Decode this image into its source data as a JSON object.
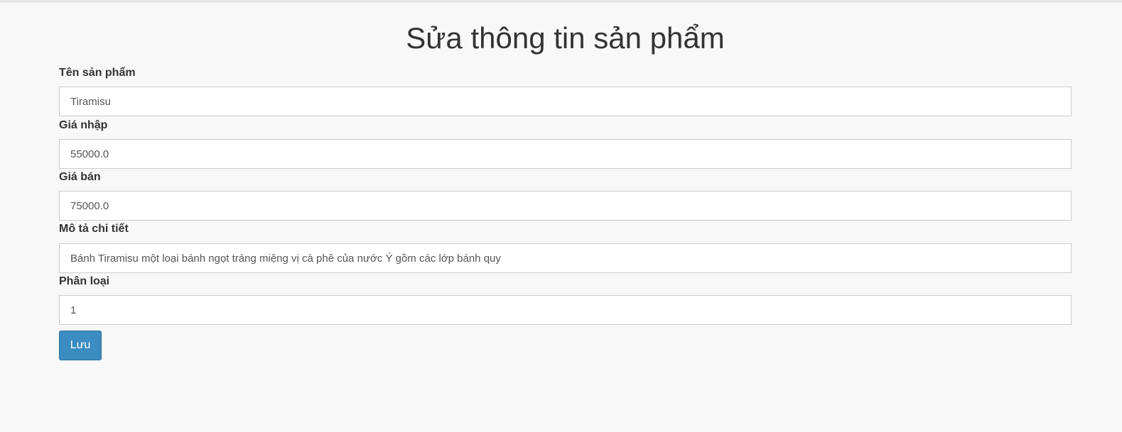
{
  "page": {
    "title": "Sửa thông tin sản phẩm"
  },
  "form": {
    "fields": [
      {
        "label": "Tên sản phẩm",
        "value": "Tiramisu"
      },
      {
        "label": "Giá nhập",
        "value": "55000.0"
      },
      {
        "label": "Giá bán",
        "value": "75000.0"
      },
      {
        "label": "Mô tả chi tiết",
        "value": "Bánh Tiramisu một loại bánh ngọt tráng miệng vị cà phê của nước Ý gồm các lớp bánh quy"
      },
      {
        "label": "Phân loại",
        "value": "1"
      }
    ],
    "save_label": "Lưu"
  },
  "colors": {
    "background": "#f8f8f8",
    "button": "#3a8cc1",
    "text": "#333333"
  }
}
